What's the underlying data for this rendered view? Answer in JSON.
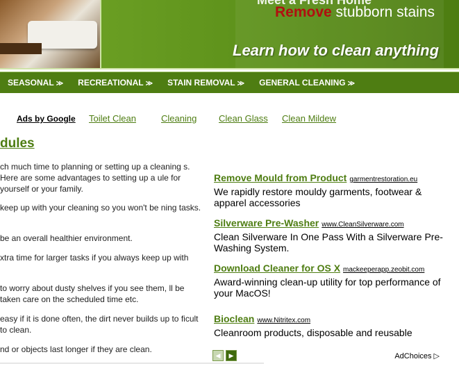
{
  "banner": {
    "top_text": "Meet a Fresh Home",
    "remove_word": "Remove",
    "remove_rest": "stubborn stains",
    "tagline": "Learn how to clean anything"
  },
  "nav": {
    "items": [
      {
        "label": "SEASONAL"
      },
      {
        "label": "RECREATIONAL"
      },
      {
        "label": "STAIN REMOVAL"
      },
      {
        "label": "GENERAL CLEANING"
      }
    ]
  },
  "ads_links": {
    "ads_by": "Ads by Google",
    "links": [
      "Toilet Clean",
      "Cleaning",
      "Clean Glass",
      "Clean Mildew"
    ]
  },
  "article": {
    "heading": "dules",
    "paragraphs": [
      "ch much time to planning or setting up a cleaning s.  Here are some advantages to setting up a ule for yourself or your family.",
      " keep up with your cleaning so you won't be ning tasks.",
      "be an overall healthier environment.",
      "xtra time for larger tasks if you always keep up with",
      "to worry about dusty shelves if you see them, ll be taken care on the scheduled time etc.",
      " easy if it is done often, the dirt never builds up to ficult to clean.",
      "nd or objects last longer if they are clean."
    ]
  },
  "ads": [
    {
      "title": "Remove Mould from Product",
      "url": "garmentrestoration.eu",
      "desc": "We rapidly restore mouldy garments, footwear & apparel accessories"
    },
    {
      "title": "Silverware Pre-Washer",
      "url": "www.CleanSilverware.com",
      "desc": "Clean Silverware In One Pass With a Silverware Pre-Washing System."
    },
    {
      "title": "Download Cleaner for OS X",
      "url": "mackeeperapp.zeobit.com",
      "desc": "Award-winning clean-up utility for top performance of your MacOS!"
    },
    {
      "title": "Bioclean",
      "url": "www.Nitritex.com",
      "desc": "Cleanroom products, disposable and reusable"
    }
  ],
  "footer": {
    "prev_icon": "◀",
    "next_icon": "▶",
    "adchoices": "AdChoices"
  }
}
